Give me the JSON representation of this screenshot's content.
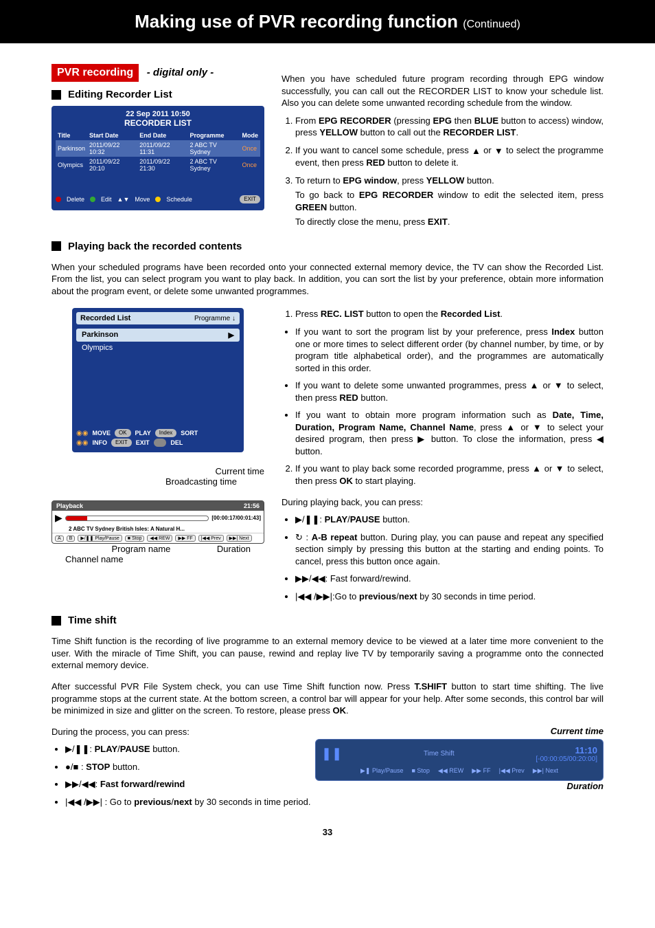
{
  "titleBar": {
    "main": "Making use of PVR recording function ",
    "cont": "(Continued)"
  },
  "pvr": {
    "heading": "PVR recording",
    "digital": "- digital only -"
  },
  "editingRecorder": {
    "heading": "Editing Recorder List",
    "datetime": "22 Sep 2011  10:50",
    "listTitle": "RECORDER LIST",
    "cols": {
      "title": "Title",
      "start": "Start Date",
      "end": "End Date",
      "prog": "Programme",
      "mode": "Mode"
    },
    "rows": [
      {
        "title": "Parkinson",
        "start": "2011/09/22 10:32",
        "end": "2011/09/22 11:31",
        "prog": "2 ABC  TV  Sydney",
        "mode": "Once"
      },
      {
        "title": "Olympics",
        "start": "2011/09/22 20:10",
        "end": "2011/09/22 21:30",
        "prog": "2 ABC  TV  Sydney",
        "mode": "Once"
      }
    ],
    "footer": {
      "delete": "Delete",
      "edit": "Edit",
      "move": "Move",
      "schedule": "Schedule",
      "exit": "EXIT"
    }
  },
  "rightText": {
    "intro": "When you have scheduled future program recording through EPG window successfully, you can call out the RECORDER LIST to know your schedule list. Also you can delete some unwanted recording schedule from the window.",
    "s1a": "From ",
    "s1b": "EPG RECORDER",
    "s1c": " (pressing ",
    "s1d": "EPG",
    "s1e": " then ",
    "s1f": "BLUE",
    "s1g": " button to access) window, press ",
    "s1h": "YELLOW",
    "s1i": " button to call out the ",
    "s1j": "RECORDER LIST",
    "s1k": ".",
    "s2a": "If you want to cancel some schedule, press ",
    "s2b": " or ",
    "s2c": " to select the programme event, then press ",
    "s2d": "RED",
    "s2e": " button to delete it.",
    "s3a": "To return to ",
    "s3b": "EPG window",
    "s3c": ", press ",
    "s3d": "YELLOW",
    "s3e": " button.",
    "s3p2a": "To go back to ",
    "s3p2b": "EPG RECORDER",
    "s3p2c": " window to edit the selected item, press ",
    "s3p2d": "GREEN",
    "s3p2e": " button.",
    "s3p3a": "To directly close the menu, press ",
    "s3p3b": "EXIT",
    "s3p3c": "."
  },
  "playback": {
    "heading": "Playing back the recorded contents",
    "intro": "When your scheduled programs have been recorded onto your connected external memory device, the TV can show the Recorded List. From the list, you can select program you want to play back. In addition, you can sort the list by your preference, obtain more information about the program event, or delete some unwanted programmes.",
    "recList": {
      "title": "Recorded List",
      "sortLabel": "Programme",
      "items": [
        "Parkinson",
        "Olympics"
      ],
      "footer": {
        "move": "MOVE",
        "ok": "OK",
        "play": "PLAY",
        "index": "Index",
        "sort": "SORT",
        "info": "INFO",
        "exit": "EXIT",
        "exitLbl": "EXIT",
        "del": "DEL"
      }
    },
    "annots": {
      "curtime": "Current time",
      "btime": "Broadcasting time",
      "pname": "Program name",
      "duration": "Duration",
      "cname": "Channel name"
    },
    "pbBar": {
      "title": "Playback",
      "time": "21:56",
      "duration": "[00:00:17/00:01:43]",
      "line2": "2 ABC TV Sydney  British Isles: A Natural H...",
      "buttons": {
        "a": "A",
        "b": "B",
        "pp": "Play/Pause",
        "stop": "Stop",
        "rew": "REW",
        "ff": "FF",
        "prev": "Prev",
        "next": "Next"
      }
    },
    "right": {
      "s1a": "Press ",
      "s1b": "REC. LIST",
      "s1c": " button to open the ",
      "s1d": "Recorded List",
      "s1e": ".",
      "b1a": "If you want to sort the program list by your preference, press ",
      "b1b": "Index",
      "b1c": " button one or more times to select different order (by channel number, by time, or by program title alphabetical order), and the programmes are automatically sorted in this order.",
      "b2a": "If you want to delete some unwanted programmes, press ",
      "b2b": " or ",
      "b2c": " to select, then press ",
      "b2d": "RED",
      "b2e": " button.",
      "b3a": "If you want to obtain more program information such as ",
      "b3b": "Date, Time, Duration, Program Name, Channel Name",
      "b3c": ", press ",
      "b3d": " or ",
      "b3e": " to select your desired program, then press ",
      "b3f": " button. To close the information, press ",
      "b3g": " button.",
      "s2a": "If you want to play back some recorded programme, press ",
      "s2b": " or ",
      "s2c": " to select, then press ",
      "s2d": "OK",
      "s2e": " to start playing.",
      "during": "During playing back, you can press:",
      "d1b": "PLAY",
      "d1c": "PAUSE",
      "d1d": " button.",
      "d2b": "A-B repeat",
      "d2c": " button. During play, you can pause and repeat any specified section simply by pressing this button at the starting and ending points. To cancel, press this button once again.",
      "d3": ": Fast forward/rewind.",
      "d4a": ":Go to ",
      "d4b": "previous",
      "d4c": "next",
      "d4d": " by 30 seconds in time period."
    }
  },
  "timeshift": {
    "heading": "Time shift",
    "p1": "Time Shift function is the recording of live programme to an external memory device to be viewed at a later time more convenient to the user. With the miracle of Time Shift, you can pause, rewind and replay live TV by temporarily saving a programme onto the connected external memory device.",
    "p2a": "After successful PVR File System check, you can use Time Shift function now. Press ",
    "p2b": "T.SHIFT",
    "p2c": " button to start time shifting. The live programme stops at the current state. At the bottom screen, a control bar will appear for your help. After some seconds, this control bar will be minimized in size and glitter on the screen. To restore, please press ",
    "p2d": "OK",
    "p2e": ".",
    "p3": "During the process, you can press:",
    "b1b": "PLAY",
    "b1c": "PAUSE",
    "b1d": " button.",
    "b2b": "STOP",
    "b2c": " button.",
    "b3": "Fast forward/rewind",
    "b4a": " : Go to ",
    "b4b": "previous",
    "b4c": "next",
    "b4d": " by 30 seconds in time period.",
    "labels": {
      "curtime": "Current time",
      "duration": "Duration"
    },
    "box": {
      "title": "Time Shift",
      "time": "11:10",
      "dur": "[-00:00:05/00:20:00]",
      "buttons": {
        "pp": "Play/Pause",
        "stop": "Stop",
        "rew": "REW",
        "ff": "FF",
        "prev": "Prev",
        "next": "Next"
      }
    }
  },
  "pageNum": "33"
}
